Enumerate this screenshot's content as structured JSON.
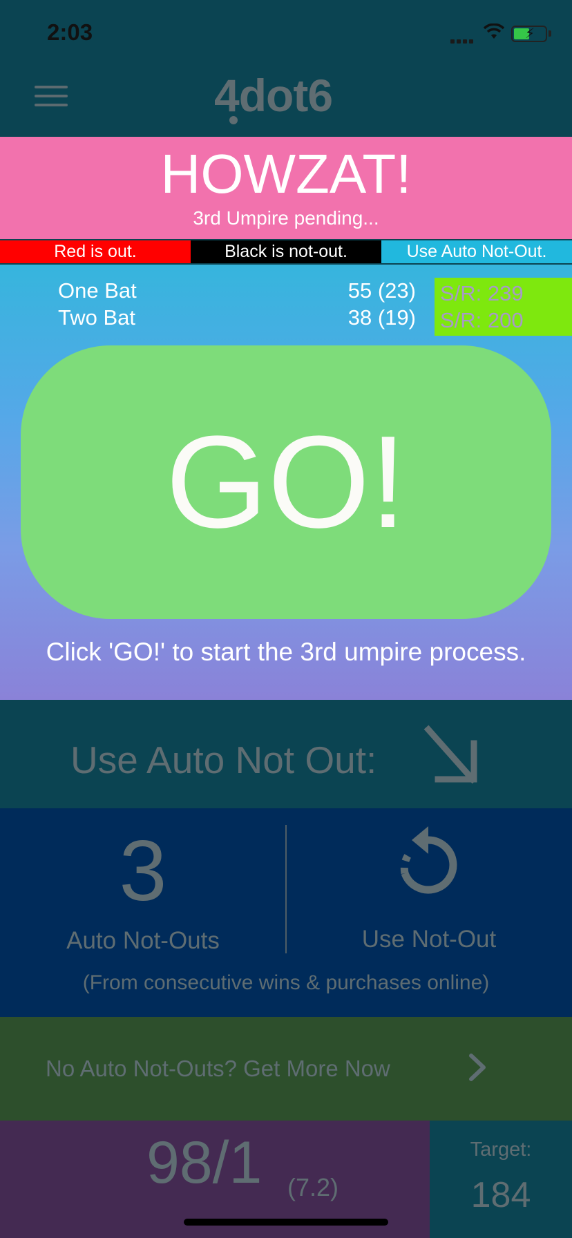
{
  "status_bar": {
    "time": "2:03"
  },
  "header": {
    "logo": "4dot6",
    "menu_icon": "hamburger-menu-icon"
  },
  "banner": {
    "title": "HOWZAT!",
    "subtitle": "3rd Umpire pending..."
  },
  "legend": {
    "red": "Red is out.",
    "black": "Black is not-out.",
    "blue": "Use Auto Not-Out."
  },
  "batters": [
    {
      "name": "One Bat",
      "score": "55 (23)",
      "strike_rate": "S/R: 239"
    },
    {
      "name": "Two Bat",
      "score": "38 (19)",
      "strike_rate": "S/R: 200"
    }
  ],
  "go": {
    "label": "GO!",
    "hint": "Click 'GO!' to start the 3rd umpire process."
  },
  "auto_not_out": {
    "label": "Use Auto Not Out:",
    "arrow_icon": "arrow-down-right-icon"
  },
  "counts": {
    "value": "3",
    "value_label": "Auto Not-Outs",
    "use_label": "Use Not-Out",
    "note": "(From consecutive wins & purchases online)"
  },
  "get_more": {
    "label": "No Auto Not-Outs? Get More Now"
  },
  "scoreboard": {
    "runs": "98/1",
    "overs": "(7.2)",
    "target_label": "Target:",
    "target_value": "184"
  },
  "colors": {
    "howzat_pink": "#f272ad",
    "go_green": "#7edc7a",
    "sr_green": "#7ee80e",
    "dark_teal": "#0b4452",
    "navy": "#002b5a",
    "forest": "#2d4f2c",
    "plum": "#442a52"
  }
}
